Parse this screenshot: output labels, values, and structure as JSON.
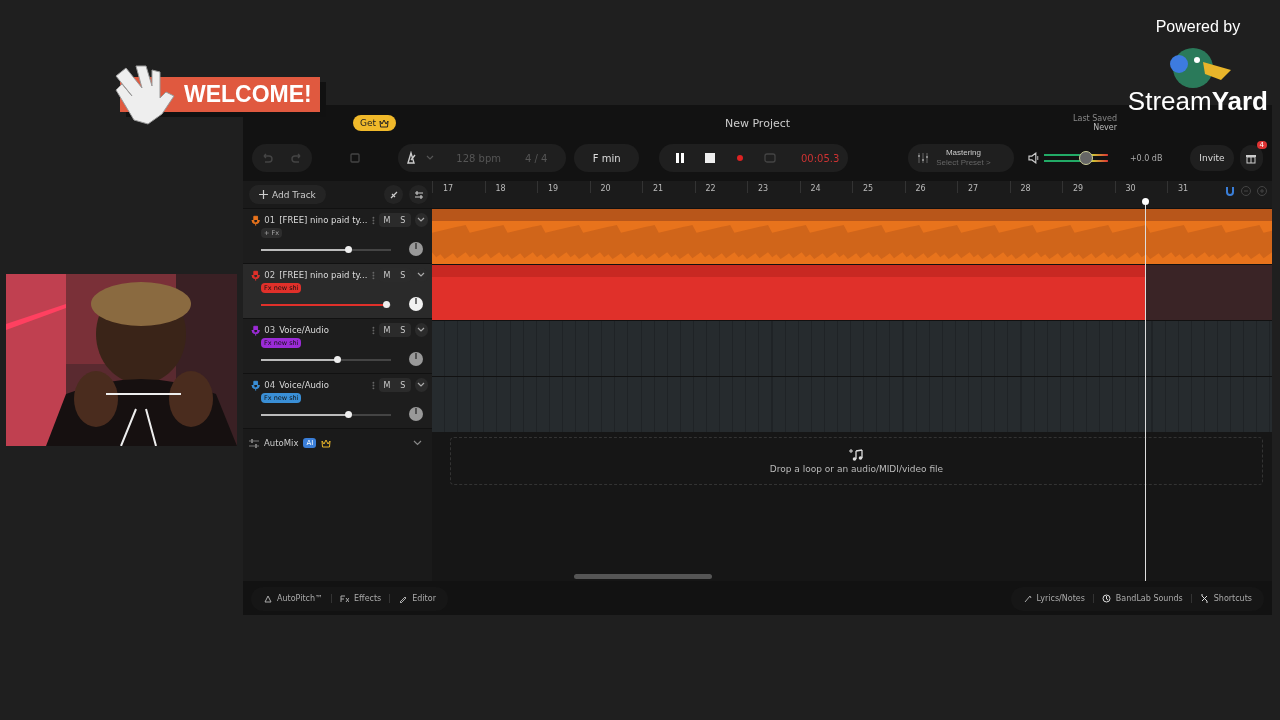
{
  "overlay": {
    "banner": "WELCOME!",
    "powered_by": "Powered by",
    "brand": "Stream**Yard**"
  },
  "daw": {
    "get_button": "Get",
    "title": "New Project",
    "last_saved_label": "Last Saved",
    "last_saved_value": "Never",
    "toolbar": {
      "tempo": "128 bpm",
      "time_signature": "4 / 4",
      "key": "F min",
      "playing": true,
      "time": "00:05.3",
      "mastering_title": "Mastering",
      "mastering_preset": "Select Preset >",
      "master_volume": {
        "level": 0.66
      },
      "master_reading": "+0.0 dB",
      "invite": "Invite",
      "gift_badge": "4"
    },
    "add_track": "Add Track",
    "ruler": [
      "17",
      "18",
      "19",
      "20",
      "21",
      "22",
      "23",
      "24",
      "25",
      "26",
      "27",
      "28",
      "29",
      "30",
      "31"
    ],
    "playhead": {
      "level": 0.849
    },
    "tracks": [
      {
        "number": "01",
        "name": "[FREE] nino paid ty...",
        "fx_tag": {
          "kind": "add",
          "label": "+ Fx"
        },
        "mute": "M",
        "solo": "S",
        "color": "#e8731c",
        "selected": false,
        "volume": {
          "level": 0.68
        },
        "clip": {
          "kind": "waveform"
        }
      },
      {
        "number": "02",
        "name": "[FREE] nino paid ty...",
        "fx_tag": {
          "kind": "fx",
          "label": "Fx new shi"
        },
        "mute": "M",
        "solo": "S",
        "color": "#e0302a",
        "selected": true,
        "volume": {
          "level": 0.97
        },
        "clip": {
          "kind": "recording"
        }
      },
      {
        "number": "03",
        "name": "Voice/Audio",
        "fx_tag": {
          "kind": "fx",
          "label": "Fx new shi"
        },
        "mute": "M",
        "solo": "S",
        "color": "#9b2bd6",
        "selected": false,
        "volume": {
          "level": 0.59
        }
      },
      {
        "number": "04",
        "name": "Voice/Audio",
        "fx_tag": {
          "kind": "fx",
          "label": "Fx new shi"
        },
        "mute": "M",
        "solo": "S",
        "color": "#3a8fd6",
        "selected": false,
        "volume": {
          "level": 0.68
        }
      }
    ],
    "automix": {
      "label": "AutoMix",
      "badge": "AI"
    },
    "drop_zone": "Drop a loop or an audio/MIDI/video file",
    "bottom_left": [
      {
        "kind": "autopitch",
        "label": "AutoPitch™"
      },
      {
        "kind": "effects",
        "label": "Effects"
      },
      {
        "kind": "editor",
        "label": "Editor"
      }
    ],
    "bottom_right": [
      {
        "kind": "lyrics",
        "label": "Lyrics/Notes"
      },
      {
        "kind": "sounds",
        "label": "BandLab Sounds"
      },
      {
        "kind": "shortcuts",
        "label": "Shortcuts"
      }
    ]
  }
}
